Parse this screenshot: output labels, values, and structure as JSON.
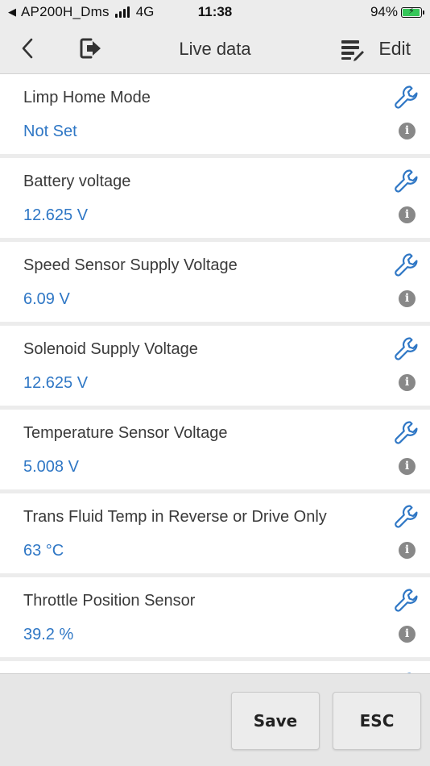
{
  "status_bar": {
    "back_glyph": "◀",
    "carrier": "AP200H_Dms",
    "network": "4G",
    "time": "11:38",
    "battery_percent": "94%",
    "battery_level": 0.94
  },
  "nav": {
    "title": "Live data",
    "edit_label": "Edit"
  },
  "rows": [
    {
      "label": "Limp Home Mode",
      "value": "Not Set"
    },
    {
      "label": "Battery voltage",
      "value": "12.625 V"
    },
    {
      "label": "Speed Sensor Supply Voltage",
      "value": "6.09 V"
    },
    {
      "label": "Solenoid Supply Voltage",
      "value": "12.625 V"
    },
    {
      "label": "Temperature Sensor Voltage",
      "value": "5.008 V"
    },
    {
      "label": "Trans Fluid Temp in Reverse or Drive Only",
      "value": "63 °C"
    },
    {
      "label": "Throttle Position Sensor",
      "value": "39.2 %"
    }
  ],
  "info_glyph": "i",
  "buttons": {
    "save": "Save",
    "esc": "ESC"
  },
  "colors": {
    "value_blue": "#2f77c5",
    "wrench_blue": "#2f77c5",
    "battery_green": "#35c759"
  }
}
